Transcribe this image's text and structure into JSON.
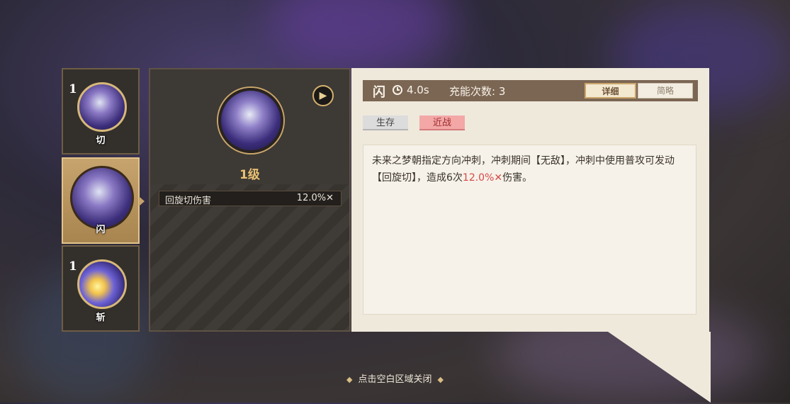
{
  "skill_tabs": [
    {
      "level": "1",
      "tag": "切",
      "icon": "sword-slash-icon"
    },
    {
      "level": "",
      "tag": "闪",
      "icon": "character-portrait-icon"
    },
    {
      "level": "1",
      "tag": "斩",
      "icon": "lightning-slash-icon"
    }
  ],
  "middle": {
    "level_label": "1级",
    "stat_name": "回旋切伤害",
    "stat_value": "12.0%✕"
  },
  "detail": {
    "skill_name": "闪",
    "cooldown": "4.0s",
    "charges": "充能次数: 3",
    "detail_button": "详细",
    "brief_button": "简略",
    "tags": [
      "生存",
      "近战"
    ],
    "description_parts": {
      "p1": "未来之梦朝指定方向冲刺，冲刺期间【无敌】，冲刺中使用普攻可发动【回旋切】，造成6次",
      "highlight": "12.0%✕",
      "p2": "伤害。"
    }
  },
  "close_hint": "点击空白区域关闭",
  "colors": {
    "highlight": "#d64848",
    "accent_gold": "#e8c173"
  }
}
